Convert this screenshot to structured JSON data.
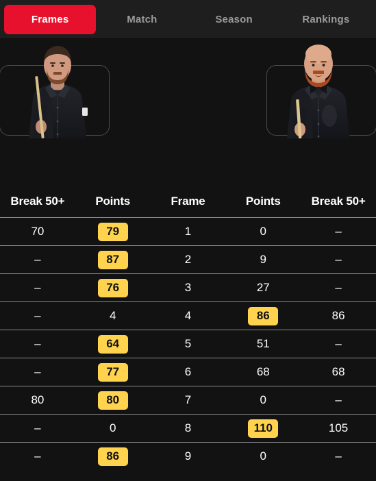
{
  "tabs": [
    {
      "label": "Frames",
      "active": true
    },
    {
      "label": "Match",
      "active": false
    },
    {
      "label": "Season",
      "active": false
    },
    {
      "label": "Rankings",
      "active": false
    }
  ],
  "players": {
    "left": {
      "alt": "left-player-photo"
    },
    "right": {
      "alt": "right-player-photo"
    }
  },
  "table": {
    "headers": [
      "Break 50+",
      "Points",
      "Frame",
      "Points",
      "Break 50+"
    ],
    "rows": [
      {
        "break_left": "70",
        "points_left": "79",
        "points_left_badge": true,
        "frame": "1",
        "points_right": "0",
        "points_right_badge": false,
        "break_right": "–"
      },
      {
        "break_left": "–",
        "points_left": "87",
        "points_left_badge": true,
        "frame": "2",
        "points_right": "9",
        "points_right_badge": false,
        "break_right": "–"
      },
      {
        "break_left": "–",
        "points_left": "76",
        "points_left_badge": true,
        "frame": "3",
        "points_right": "27",
        "points_right_badge": false,
        "break_right": "–"
      },
      {
        "break_left": "–",
        "points_left": "4",
        "points_left_badge": false,
        "frame": "4",
        "points_right": "86",
        "points_right_badge": true,
        "break_right": "86"
      },
      {
        "break_left": "–",
        "points_left": "64",
        "points_left_badge": true,
        "frame": "5",
        "points_right": "51",
        "points_right_badge": false,
        "break_right": "–"
      },
      {
        "break_left": "–",
        "points_left": "77",
        "points_left_badge": true,
        "frame": "6",
        "points_right": "68",
        "points_right_badge": false,
        "break_right": "68"
      },
      {
        "break_left": "80",
        "points_left": "80",
        "points_left_badge": true,
        "frame": "7",
        "points_right": "0",
        "points_right_badge": false,
        "break_right": "–"
      },
      {
        "break_left": "–",
        "points_left": "0",
        "points_left_badge": false,
        "frame": "8",
        "points_right": "110",
        "points_right_badge": true,
        "break_right": "105"
      },
      {
        "break_left": "–",
        "points_left": "86",
        "points_left_badge": true,
        "frame": "9",
        "points_right": "0",
        "points_right_badge": false,
        "break_right": "–"
      }
    ]
  },
  "colors": {
    "background": "#121212",
    "tabbar_background": "#1e1e1e",
    "active_tab": "#e8112d",
    "badge": "#ffd34e",
    "separator": "#8e8e8e",
    "inactive_tab_text": "#9a9a9a"
  }
}
